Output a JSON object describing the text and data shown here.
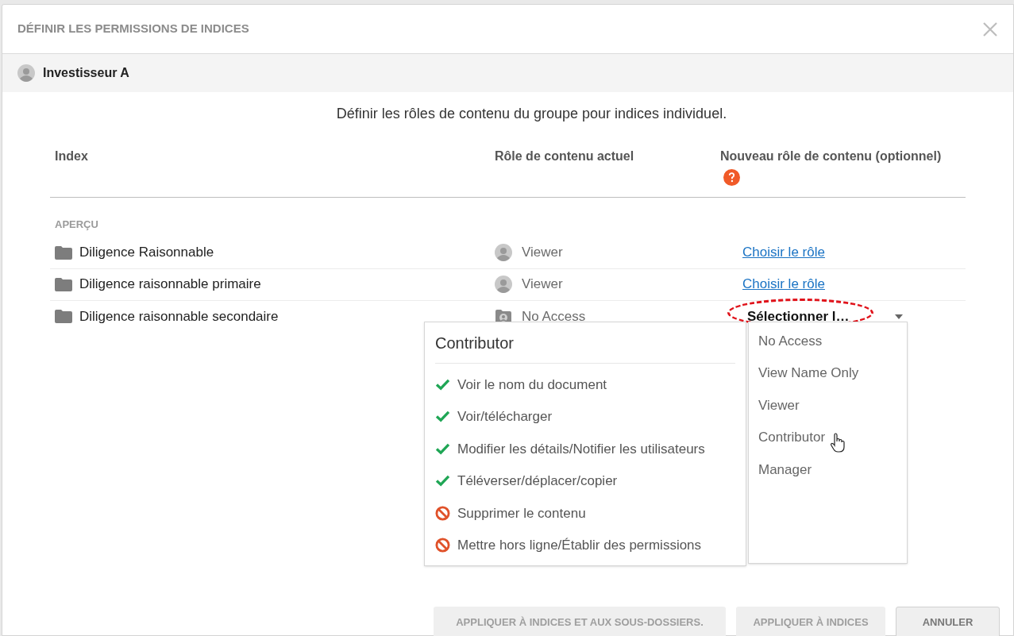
{
  "dialog": {
    "title": "DÉFINIR LES PERMISSIONS DE INDICES",
    "user": "Investisseur A",
    "instructions": "Définir les rôles de contenu du groupe pour indices individuel."
  },
  "table": {
    "columns": [
      "Index",
      "Rôle de contenu actuel",
      "Nouveau rôle de contenu (optionnel)"
    ],
    "section": "APERÇU",
    "rows": [
      {
        "name": "Diligence Raisonnable",
        "current_role": {
          "kind": "member",
          "label": "Viewer"
        },
        "new_role": {
          "kind": "link",
          "label": "Choisir le rôle"
        }
      },
      {
        "name": "Diligence raisonnable primaire",
        "current_role": {
          "kind": "member",
          "label": "Viewer"
        },
        "new_role": {
          "kind": "link",
          "label": "Choisir le rôle"
        }
      },
      {
        "name": "Diligence raisonnable secondaire",
        "current_role": {
          "kind": "no_access",
          "label": "No Access"
        },
        "new_role": {
          "kind": "select",
          "label": "Sélectionner l…"
        }
      }
    ]
  },
  "role_details": {
    "title": "Contributor",
    "permissions": [
      {
        "label": "Voir le nom du document",
        "allowed": true
      },
      {
        "label": "Voir/télécharger",
        "allowed": true
      },
      {
        "label": "Modifier les détails/Notifier les utilisateurs",
        "allowed": true
      },
      {
        "label": "Téléverser/déplacer/copier",
        "allowed": true
      },
      {
        "label": "Supprimer le contenu",
        "allowed": false
      },
      {
        "label": "Mettre hors ligne/Établir des permissions",
        "allowed": false
      }
    ]
  },
  "role_options": [
    {
      "label": "No Access",
      "hovered": false
    },
    {
      "label": "View Name Only",
      "hovered": false
    },
    {
      "label": "Viewer",
      "hovered": false
    },
    {
      "label": "Contributor",
      "hovered": true
    },
    {
      "label": "Manager",
      "hovered": false
    }
  ],
  "buttons": [
    {
      "label": "APPLIQUER À INDICES ET AUX SOUS-DOSSIERS.",
      "disabled": true
    },
    {
      "label": "APPLIQUER À INDICES",
      "disabled": true
    },
    {
      "label": "ANNULER",
      "disabled": false
    }
  ]
}
